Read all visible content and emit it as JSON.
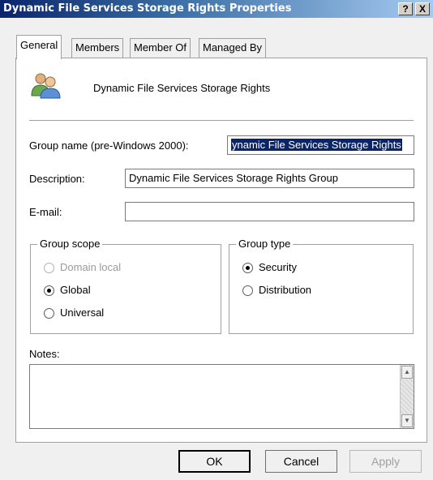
{
  "window": {
    "title": "Dynamic File Services Storage Rights Properties",
    "help_btn": "?",
    "close_btn": "X"
  },
  "tabs": [
    "General",
    "Members",
    "Member Of",
    "Managed By"
  ],
  "header": {
    "group_display_name": "Dynamic File Services Storage Rights"
  },
  "fields": {
    "group_name_label": "Group name (pre-Windows 2000):",
    "group_name_value": "ynamic File Services Storage Rights",
    "description_label": "Description:",
    "description_value": "Dynamic File Services Storage Rights Group",
    "email_label": "E-mail:",
    "email_value": ""
  },
  "group_scope": {
    "legend": "Group scope",
    "options": [
      "Domain local",
      "Global",
      "Universal"
    ],
    "selected": "Global",
    "disabled": [
      "Domain local"
    ]
  },
  "group_type": {
    "legend": "Group type",
    "options": [
      "Security",
      "Distribution"
    ],
    "selected": "Security"
  },
  "notes": {
    "label": "Notes:",
    "value": ""
  },
  "buttons": {
    "ok": "OK",
    "cancel": "Cancel",
    "apply": "Apply"
  }
}
